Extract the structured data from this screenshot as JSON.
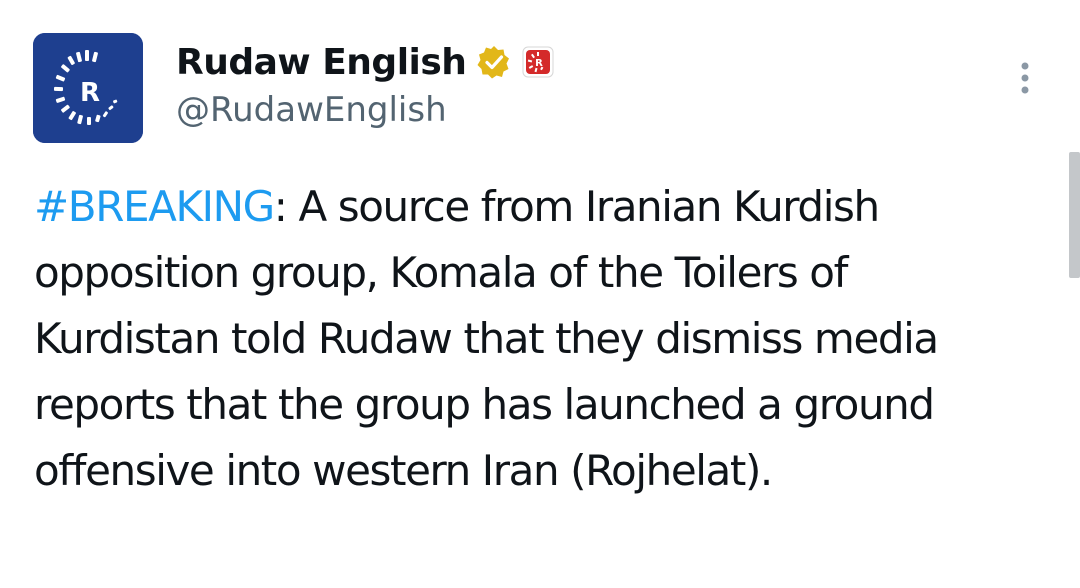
{
  "tweet": {
    "display_name": "Rudaw English",
    "handle": "@RudawEnglish",
    "verified_badge_icon": "verified-gold-check-icon",
    "affiliate_icon": "rudaw-affiliate-logo-icon",
    "avatar_letter": "R",
    "more_icon": "more-vertical-icon",
    "hashtag": "#BREAKING",
    "text": ": A source from Iranian Kurdish opposition group, Komala of the Toilers of Kurdistan told Rudaw that they dismiss media reports that the group has launched a ground offensive into western Iran (Rojhelat)."
  },
  "colors": {
    "hashtag": "#1d9bf0",
    "avatar_bg": "#1e3f8f",
    "badge_gold": "#e2b719",
    "affiliate_red": "#d42a2a",
    "secondary_text": "#536471",
    "primary_text": "#0f1419"
  }
}
